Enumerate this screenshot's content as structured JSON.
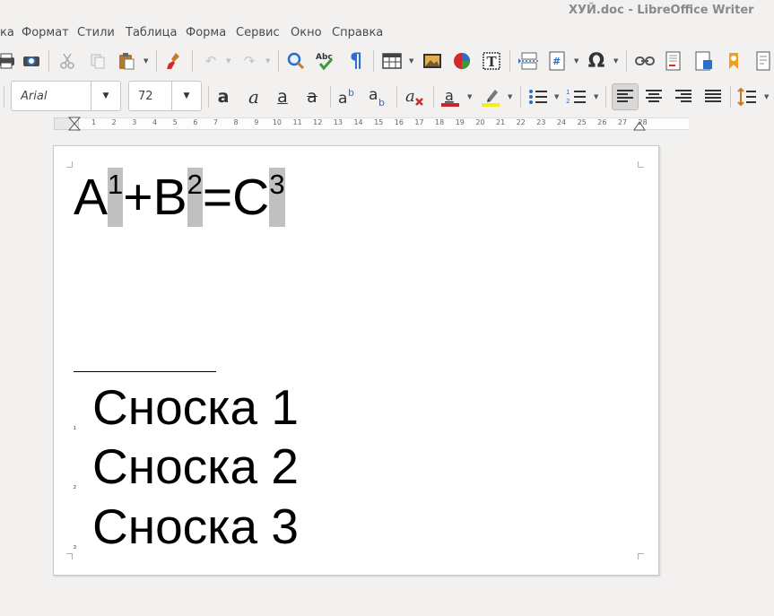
{
  "window": {
    "title": "ХУЙ.doc - LibreOffice Writer"
  },
  "menu": {
    "items": [
      "ка",
      "Формат",
      "Стили",
      "Таблица",
      "Форма",
      "Сервис",
      "Окно",
      "Справка"
    ]
  },
  "toolbar": {
    "font_name": "Arial",
    "font_size": "72",
    "colors": {
      "font_color": "#d0202a",
      "highlight": "#f5ee1c",
      "accent": "#2a6fc9"
    }
  },
  "ruler": {
    "numbers": [
      "1",
      "2",
      "3",
      "4",
      "5",
      "6",
      "7",
      "8",
      "9",
      "10",
      "11",
      "12",
      "13",
      "14",
      "15",
      "16",
      "17",
      "18",
      "19",
      "20",
      "21",
      "22",
      "23",
      "24",
      "25",
      "26",
      "27",
      "28"
    ]
  },
  "document": {
    "formula": {
      "a": "A",
      "sup1": "1",
      "plus": "+",
      "b": "B",
      "sup2": "2",
      "eq": "=",
      "c": "C",
      "sup3": "3"
    },
    "footnotes": [
      {
        "mark": "1",
        "text": "Сноска 1"
      },
      {
        "mark": "2",
        "text": "Сноска 2"
      },
      {
        "mark": "3",
        "text": "Сноска 3"
      }
    ]
  }
}
